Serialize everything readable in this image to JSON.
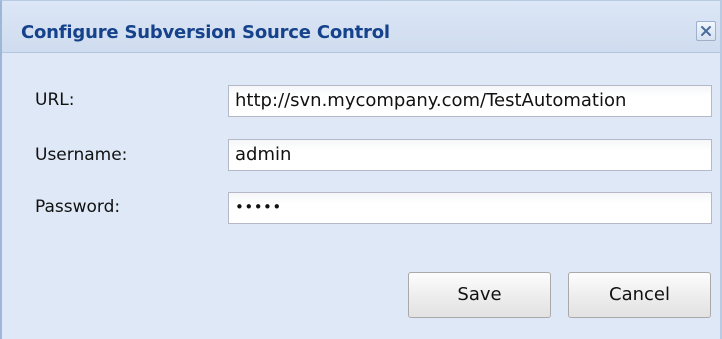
{
  "dialog": {
    "title": "Configure Subversion Source Control",
    "close_icon": "close-icon"
  },
  "form": {
    "url": {
      "label": "URL:",
      "value": "http://svn.mycompany.com/TestAutomation"
    },
    "username": {
      "label": "Username:",
      "value": "admin"
    },
    "password": {
      "label": "Password:",
      "masked_value": "•••••"
    }
  },
  "buttons": {
    "save_label": "Save",
    "cancel_label": "Cancel"
  },
  "colors": {
    "title_text": "#15428b",
    "dialog_background": "#dfe8f6",
    "field_border": "#b5b8c8"
  }
}
